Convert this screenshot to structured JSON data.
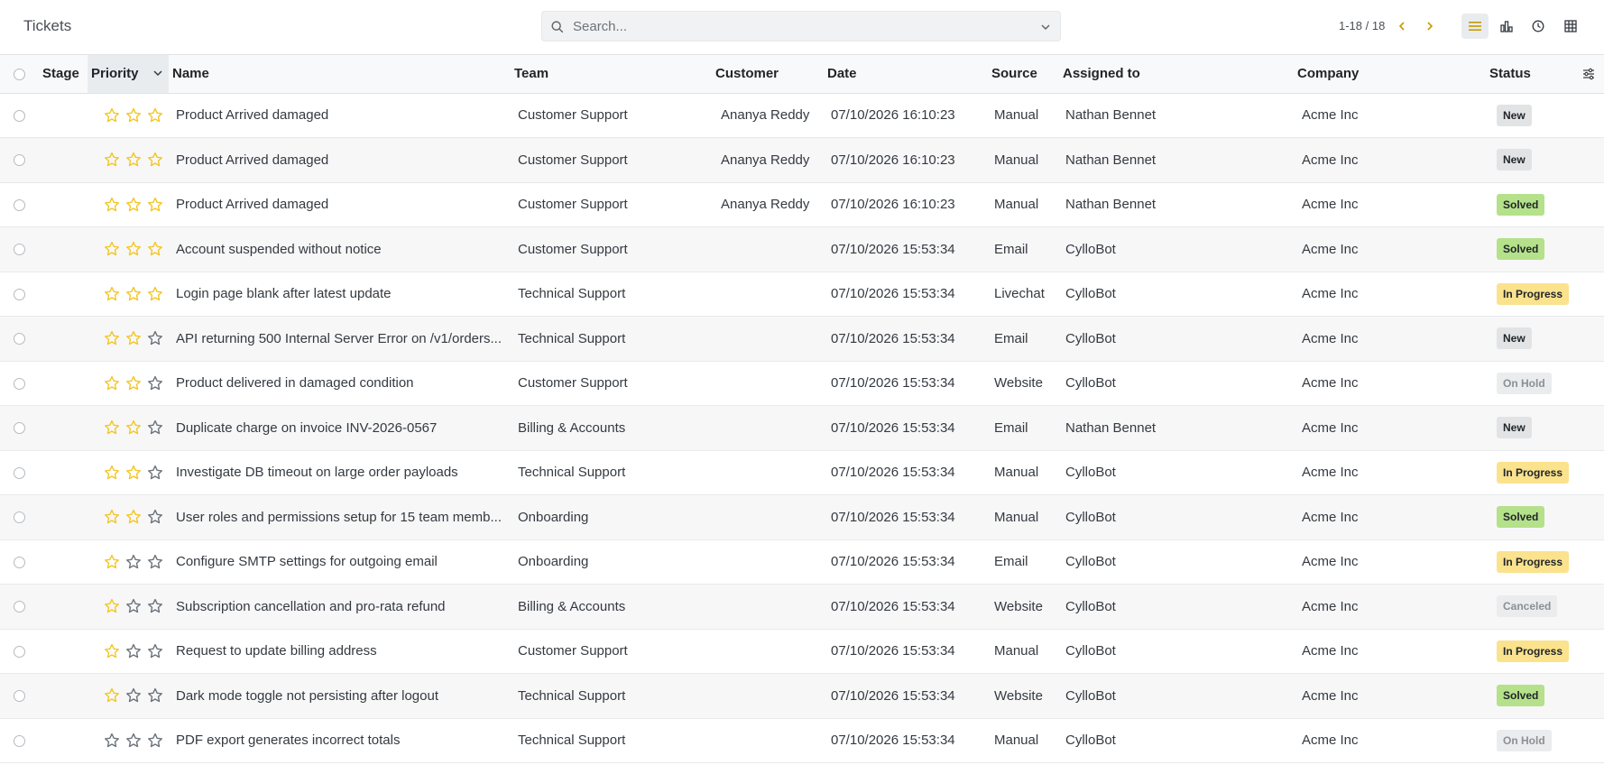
{
  "header": {
    "title": "Tickets",
    "search_placeholder": "Search...",
    "pager": "1-18 / 18"
  },
  "colors": {
    "accent": "#c69a00",
    "star_filled": "#f3c623",
    "star_empty": "#6c737a",
    "badge_new_bg": "#e2e3e5",
    "badge_solved_bg": "#b4e18a",
    "badge_progress_bg": "#fbe28d",
    "badge_onhold_bg": "#eaecee",
    "badge_canceled_bg": "#eaecee"
  },
  "columns": {
    "stage": "Stage",
    "priority": "Priority",
    "name": "Name",
    "team": "Team",
    "customer": "Customer",
    "date": "Date",
    "source": "Source",
    "assigned": "Assigned to",
    "company": "Company",
    "status": "Status"
  },
  "rows": [
    {
      "priority": 3,
      "name": "Product Arrived damaged",
      "team": "Customer Support",
      "customer": "Ananya Reddy",
      "date": "07/10/2026 16:10:23",
      "source": "Manual",
      "assigned": "Nathan Bennet",
      "company": "Acme Inc",
      "status": "New"
    },
    {
      "priority": 3,
      "name": "Product Arrived damaged",
      "team": "Customer Support",
      "customer": "Ananya Reddy",
      "date": "07/10/2026 16:10:23",
      "source": "Manual",
      "assigned": "Nathan Bennet",
      "company": "Acme Inc",
      "status": "New"
    },
    {
      "priority": 3,
      "name": "Product Arrived damaged",
      "team": "Customer Support",
      "customer": "Ananya Reddy",
      "date": "07/10/2026 16:10:23",
      "source": "Manual",
      "assigned": "Nathan Bennet",
      "company": "Acme Inc",
      "status": "Solved"
    },
    {
      "priority": 3,
      "name": "Account suspended without notice",
      "team": "Customer Support",
      "customer": "",
      "date": "07/10/2026 15:53:34",
      "source": "Email",
      "assigned": "CylloBot",
      "company": "Acme Inc",
      "status": "Solved"
    },
    {
      "priority": 3,
      "name": "Login page blank after latest update",
      "team": "Technical Support",
      "customer": "",
      "date": "07/10/2026 15:53:34",
      "source": "Livechat",
      "assigned": "CylloBot",
      "company": "Acme Inc",
      "status": "In Progress"
    },
    {
      "priority": 2,
      "name": "API returning 500 Internal Server Error on /v1/orders...",
      "team": "Technical Support",
      "customer": "",
      "date": "07/10/2026 15:53:34",
      "source": "Email",
      "assigned": "CylloBot",
      "company": "Acme Inc",
      "status": "New"
    },
    {
      "priority": 2,
      "name": "Product delivered in damaged condition",
      "team": "Customer Support",
      "customer": "",
      "date": "07/10/2026 15:53:34",
      "source": "Website",
      "assigned": "CylloBot",
      "company": "Acme Inc",
      "status": "On Hold"
    },
    {
      "priority": 2,
      "name": "Duplicate charge on invoice INV-2026-0567",
      "team": "Billing & Accounts",
      "customer": "",
      "date": "07/10/2026 15:53:34",
      "source": "Email",
      "assigned": "Nathan Bennet",
      "company": "Acme Inc",
      "status": "New"
    },
    {
      "priority": 2,
      "name": "Investigate DB timeout on large order payloads",
      "team": "Technical Support",
      "customer": "",
      "date": "07/10/2026 15:53:34",
      "source": "Manual",
      "assigned": "CylloBot",
      "company": "Acme Inc",
      "status": "In Progress"
    },
    {
      "priority": 2,
      "name": "User roles and permissions setup for 15 team memb...",
      "team": "Onboarding",
      "customer": "",
      "date": "07/10/2026 15:53:34",
      "source": "Manual",
      "assigned": "CylloBot",
      "company": "Acme Inc",
      "status": "Solved"
    },
    {
      "priority": 1,
      "name": "Configure SMTP settings for outgoing email",
      "team": "Onboarding",
      "customer": "",
      "date": "07/10/2026 15:53:34",
      "source": "Email",
      "assigned": "CylloBot",
      "company": "Acme Inc",
      "status": "In Progress"
    },
    {
      "priority": 1,
      "name": "Subscription cancellation and pro-rata refund",
      "team": "Billing & Accounts",
      "customer": "",
      "date": "07/10/2026 15:53:34",
      "source": "Website",
      "assigned": "CylloBot",
      "company": "Acme Inc",
      "status": "Canceled"
    },
    {
      "priority": 1,
      "name": "Request to update billing address",
      "team": "Customer Support",
      "customer": "",
      "date": "07/10/2026 15:53:34",
      "source": "Manual",
      "assigned": "CylloBot",
      "company": "Acme Inc",
      "status": "In Progress"
    },
    {
      "priority": 1,
      "name": "Dark mode toggle not persisting after logout",
      "team": "Technical Support",
      "customer": "",
      "date": "07/10/2026 15:53:34",
      "source": "Website",
      "assigned": "CylloBot",
      "company": "Acme Inc",
      "status": "Solved"
    },
    {
      "priority": 0,
      "name": "PDF export generates incorrect totals",
      "team": "Technical Support",
      "customer": "",
      "date": "07/10/2026 15:53:34",
      "source": "Manual",
      "assigned": "CylloBot",
      "company": "Acme Inc",
      "status": "On Hold"
    }
  ]
}
